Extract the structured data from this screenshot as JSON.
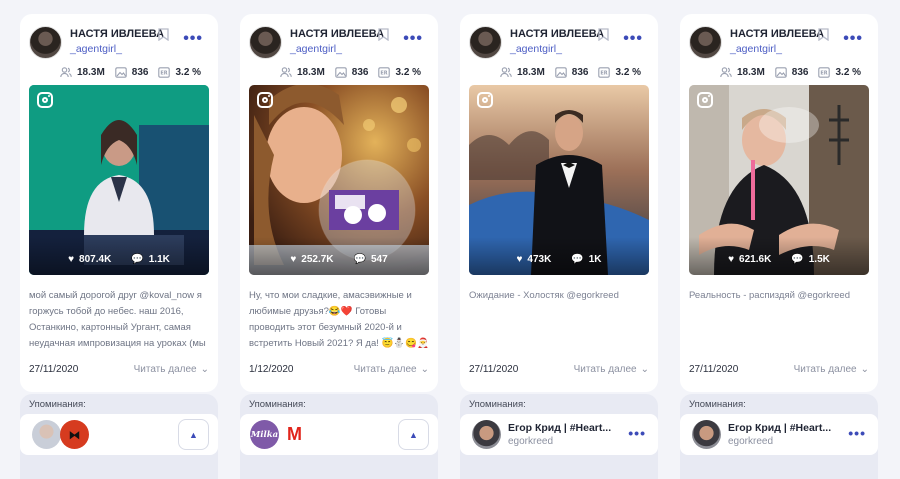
{
  "posts": [
    {
      "name": "НАСТЯ ИВЛЕЕВА",
      "handle": "_agentgirl_",
      "followers": "18.3M",
      "posts": "836",
      "er": "3.2 %",
      "likes": "807.4K",
      "comments": "1.1K",
      "caption": "мой самый дорогой друг @koval_now я горжусь тобой до небес. наш 2016, Останкино, картонный Ургант, самая неудачная импровизация на уроках (мы никогда не готовили домашку) и огромные",
      "date": "27/11/2020",
      "readmore": "Читать далее",
      "mentions_label": "Упоминания:"
    },
    {
      "name": "НАСТЯ ИВЛЕЕВА",
      "handle": "_agentgirl_",
      "followers": "18.3M",
      "posts": "836",
      "er": "3.2 %",
      "likes": "252.7K",
      "comments": "547",
      "caption": "Ну, что мои сладкие, амасэвижные и любимые друзья?😂❤️ Готовы проводить этот безумный 2020-й и встретить Новый 2021? Я да! 😇⛄😋🎅 И я очень хочу, чтобы Новый Год дарил нам",
      "date": "1/12/2020",
      "readmore": "Читать далее",
      "mentions_label": "Упоминания:"
    },
    {
      "name": "НАСТЯ ИВЛЕЕВА",
      "handle": "_agentgirl_",
      "followers": "18.3M",
      "posts": "836",
      "er": "3.2 %",
      "likes": "473K",
      "comments": "1K",
      "caption": "Ожидание - Холостяк @egorkreed",
      "date": "27/11/2020",
      "readmore": "Читать далее",
      "mentions_label": "Упоминания:",
      "mention_name": "Егор Крид | #Heart...",
      "mention_handle": "egorkreed"
    },
    {
      "name": "НАСТЯ ИВЛЕЕВА",
      "handle": "_agentgirl_",
      "followers": "18.3M",
      "posts": "836",
      "er": "3.2 %",
      "likes": "621.6K",
      "comments": "1.5K",
      "caption": "Реальность - распиздяй @egorkreed",
      "date": "27/11/2020",
      "readmore": "Читать далее",
      "mentions_label": "Упоминания:",
      "mention_name": "Егор Крид | #Heart...",
      "mention_handle": "egorkreed"
    }
  ],
  "mention_logos": {
    "milka": "Milka",
    "magnit": "M"
  },
  "colors": {
    "accent": "#3c4bb8",
    "handle": "#4d5ec4",
    "background": "#f3f4f9"
  }
}
